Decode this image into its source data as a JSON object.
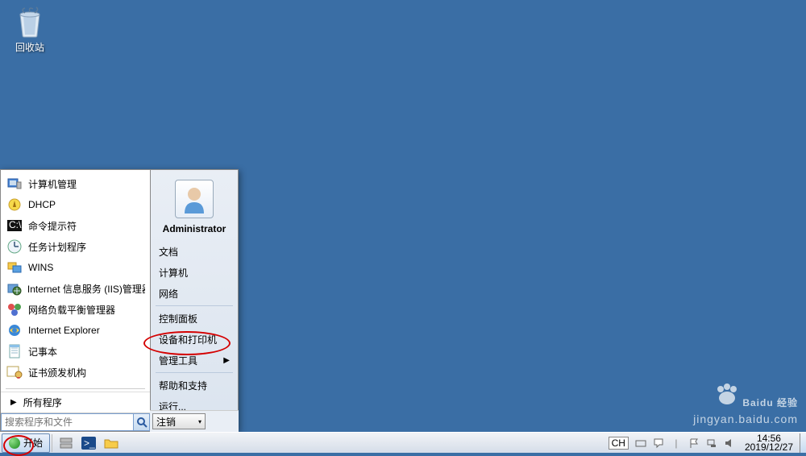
{
  "desktop": {
    "recycle_bin_label": "回收站"
  },
  "start_menu": {
    "left_apps": [
      {
        "label": "计算机管理",
        "icon": "computer-management"
      },
      {
        "label": "DHCP",
        "icon": "dhcp"
      },
      {
        "label": "命令提示符",
        "icon": "cmd"
      },
      {
        "label": "任务计划程序",
        "icon": "scheduler"
      },
      {
        "label": "WINS",
        "icon": "wins"
      },
      {
        "label": "Internet 信息服务 (IIS)管理器",
        "icon": "iis"
      },
      {
        "label": "网络负载平衡管理器",
        "icon": "nlb"
      },
      {
        "label": "Internet Explorer",
        "icon": "ie"
      },
      {
        "label": "记事本",
        "icon": "notepad"
      },
      {
        "label": "证书颁发机构",
        "icon": "cert"
      }
    ],
    "all_programs": "所有程序",
    "search_placeholder": "搜索程序和文件",
    "user_name": "Administrator",
    "right_items": [
      {
        "label": "文档",
        "sep_after": false
      },
      {
        "label": "计算机",
        "sep_after": false
      },
      {
        "label": "网络",
        "sep_after": true
      },
      {
        "label": "控制面板",
        "sep_after": false
      },
      {
        "label": "设备和打印机",
        "sep_after": false
      },
      {
        "label": "管理工具",
        "sep_after": true,
        "has_arrow": true,
        "highlighted": true
      },
      {
        "label": "帮助和支持",
        "sep_after": false
      },
      {
        "label": "运行...",
        "sep_after": false
      }
    ],
    "logoff": "注销"
  },
  "taskbar": {
    "start": "开始",
    "ime": "CH",
    "time": "14:56",
    "date": "2019/12/27"
  },
  "watermark": {
    "line1": "Baidu 经验",
    "line2": "jingyan.baidu.com"
  }
}
